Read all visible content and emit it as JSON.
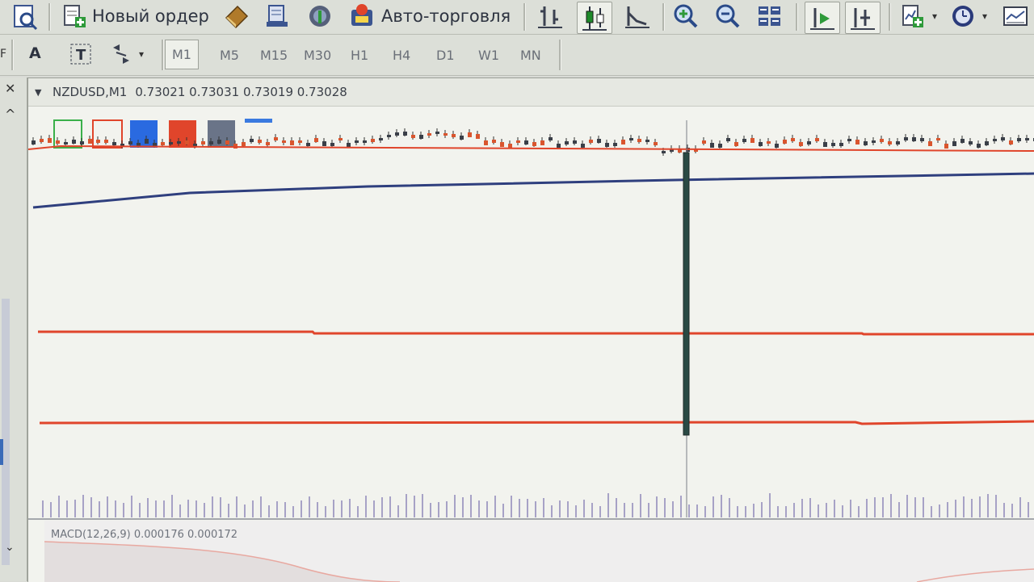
{
  "toolbar": {
    "new_order_label": "Новый ордер",
    "auto_trading_label": "Авто-торговля"
  },
  "toolbar2": {
    "timeframes": [
      "M1",
      "M5",
      "M15",
      "M30",
      "H1",
      "H4",
      "D1",
      "W1",
      "MN"
    ],
    "active_timeframe": "M1"
  },
  "chart": {
    "symbol": "NZDUSD,M1",
    "prices": "0.73021 0.73031 0.73019 0.73028",
    "macd_label": "MACD(12,26,9) 0.000176 0.000172"
  },
  "left_panel": {
    "close_label": "✕",
    "letter": "F"
  },
  "colors": {
    "red_line": "#e0452b",
    "blue_line": "#2f3f7e",
    "long_candle": "#2a4a44"
  }
}
